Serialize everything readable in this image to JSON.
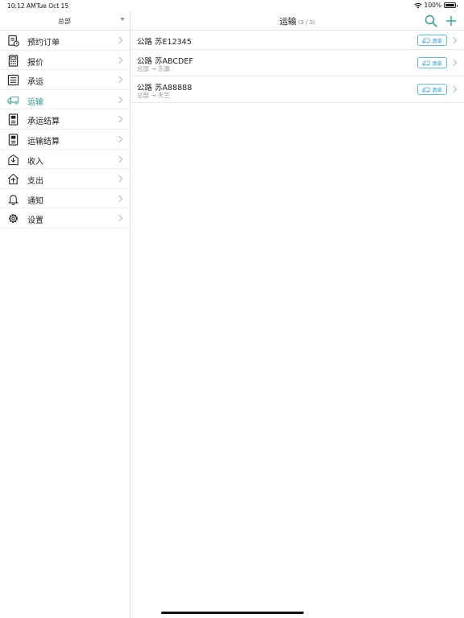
{
  "status_bar": {
    "time": "10:12 AM",
    "date": "Tue Oct 15",
    "battery": "100%"
  },
  "sidebar": {
    "title": "总部",
    "items": [
      {
        "label": "预约订单",
        "icon": "calendar-list-icon"
      },
      {
        "label": "报价",
        "icon": "calculator-icon"
      },
      {
        "label": "承运",
        "icon": "list-icon"
      },
      {
        "label": "运输",
        "icon": "truck-icon",
        "active": true
      },
      {
        "label": "承运结算",
        "icon": "ledger-icon"
      },
      {
        "label": "运输结算",
        "icon": "ledger-icon"
      },
      {
        "label": "收入",
        "icon": "income-icon"
      },
      {
        "label": "支出",
        "icon": "expense-icon"
      },
      {
        "label": "通知",
        "icon": "bell-icon"
      },
      {
        "label": "设置",
        "icon": "gear-icon"
      }
    ]
  },
  "main": {
    "title": "运输",
    "count": "(3 / 3)",
    "rows": [
      {
        "plate": "公路 苏E12345",
        "route": "",
        "badge": "清单"
      },
      {
        "plate": "公路 苏ABCDEF",
        "route": "总部 → 东瀛",
        "badge": "清单"
      },
      {
        "plate": "公路 苏A88888",
        "route": "总部 → 天竺",
        "badge": "清单"
      }
    ]
  },
  "colors": {
    "accent": "#2a9d8f",
    "badge": "#2b9fd6"
  }
}
